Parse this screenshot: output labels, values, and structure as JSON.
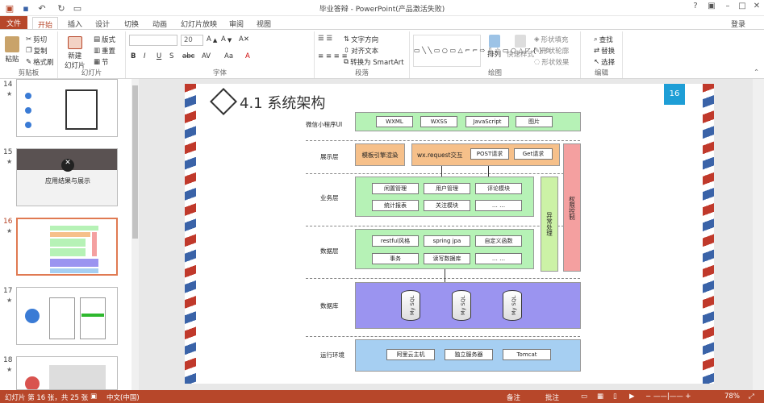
{
  "window": {
    "title": "毕业答辩 - PowerPoint(产品激活失败)",
    "help": "?",
    "login": "登录"
  },
  "tabs": [
    "文件",
    "开始",
    "插入",
    "设计",
    "切换",
    "动画",
    "幻灯片放映",
    "审阅",
    "视图"
  ],
  "ribbon": {
    "clipboard": {
      "paste": "粘贴",
      "cut": "剪切",
      "copy": "复制",
      "format_painter": "格式刷",
      "label": "剪贴板"
    },
    "slides": {
      "new_slide": "新建\n幻灯片",
      "layout": "版式",
      "reset": "重置",
      "section": "节",
      "label": "幻灯片"
    },
    "font": {
      "font_size": "20",
      "label": "字体",
      "bold": "B",
      "italic": "I",
      "underline": "U",
      "strike": "S",
      "shadow": "abc",
      "spacing": "AV",
      "case": "Aa"
    },
    "paragraph": {
      "text_direction": "文字方向",
      "align_text": "对齐文本",
      "smartart": "转换为 SmartArt",
      "label": "段落"
    },
    "drawing": {
      "arrange": "排列",
      "quick_styles": "快速样式",
      "shape_fill": "形状填充",
      "shape_outline": "形状轮廓",
      "shape_effects": "形状效果",
      "label": "绘图"
    },
    "editing": {
      "find": "查找",
      "replace": "替换",
      "select": "选择",
      "label": "编辑"
    }
  },
  "thumbnails": [
    {
      "num": "14",
      "star": "★"
    },
    {
      "num": "15",
      "star": "★",
      "caption": "应用结果与展示"
    },
    {
      "num": "16",
      "star": "★"
    },
    {
      "num": "17",
      "star": "★"
    },
    {
      "num": "18",
      "star": "★"
    }
  ],
  "slide": {
    "number": "16",
    "title": "4.1 系统架构",
    "layers": {
      "mp": "微信小程序UI",
      "show": "展示层",
      "biz": "业务层",
      "data": "数据层",
      "db": "数据库",
      "env": "运行环境"
    },
    "mp_items": [
      "WXML",
      "WXSS",
      "JavaScript",
      "图片"
    ],
    "show_items": {
      "template": "模板引擎渲染",
      "wx": "wx.request交互",
      "post": "POST请求",
      "get": "Get请求"
    },
    "biz_items": [
      "闲置管理",
      "用户管理",
      "评论模块",
      "统计报表",
      "关注模块",
      "… …"
    ],
    "data_items": [
      "restful风格",
      "spring jpa",
      "自定义函数",
      "事务",
      "读写数据库",
      "… …"
    ],
    "db_items": [
      "My SQL",
      "My SQL",
      "My SQL"
    ],
    "env_items": [
      "阿里云主机",
      "独立服务器",
      "Tomcat"
    ],
    "exception": "异常处理",
    "permission": "权限控制"
  },
  "status": {
    "slide_info": "幻灯片 第 16 张，共 25 张",
    "lang": "中文(中国)",
    "notes": "备注",
    "comments": "批注",
    "zoom": "78%"
  },
  "colors": {
    "accent": "#b7472a",
    "green": "#b6f2b6",
    "orange": "#f6c08a",
    "red": "#f4a0a0",
    "purple": "#9b94f0",
    "blue": "#a6cff2",
    "badge": "#1e9ed6"
  }
}
